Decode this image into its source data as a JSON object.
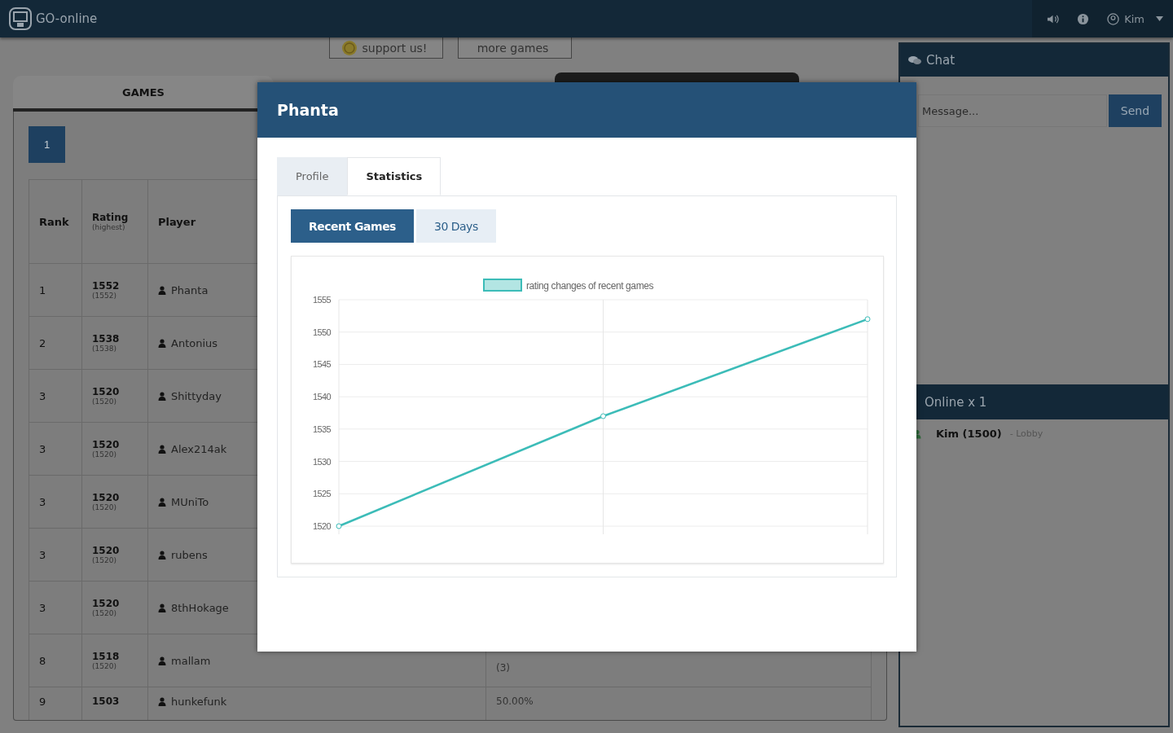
{
  "header": {
    "logo": "GO-online",
    "user": "Kim"
  },
  "top_buttons": [
    "support us!",
    "more games"
  ],
  "games_tab": {
    "label": "GAMES"
  },
  "pagination": [
    {
      "label": "1",
      "selected": true
    }
  ],
  "table": {
    "columns": [
      "Rank",
      "Rating",
      "Player"
    ],
    "rating_note": "(highest)",
    "rows": [
      {
        "rank": "1",
        "rating": "1552",
        "highest": "(1552)",
        "player": "Phanta"
      },
      {
        "rank": "2",
        "rating": "1538",
        "highest": "(1538)",
        "player": "Antonius"
      },
      {
        "rank": "3",
        "rating": "1520",
        "highest": "(1520)",
        "player": "Shittyday"
      },
      {
        "rank": "3",
        "rating": "1520",
        "highest": "(1520)",
        "player": "Alex214ak"
      },
      {
        "rank": "3",
        "rating": "1520",
        "highest": "(1520)",
        "player": "MUniTo"
      },
      {
        "rank": "3",
        "rating": "1520",
        "highest": "(1520)",
        "player": "rubens"
      },
      {
        "rank": "3",
        "rating": "1520",
        "highest": "(1520)",
        "player": "8thHokage"
      },
      {
        "rank": "8",
        "rating": "1518",
        "highest": "(1520)",
        "player": "mallam",
        "column_4_note": "(3)"
      },
      {
        "rank": "9",
        "rating": "1503",
        "player": "hunkefunk",
        "column_4": "50.00%"
      }
    ]
  },
  "chat": {
    "title": "Chat",
    "placeholder": "Message...",
    "send": "Send"
  },
  "online": {
    "title": "Online x 1",
    "users": [
      {
        "name": "Kim (1500)",
        "status": "- Lobby"
      }
    ]
  },
  "modal": {
    "title": "Phanta",
    "tabs": [
      {
        "label": "Profile",
        "selected": false
      },
      {
        "label": "Statistics",
        "selected": true
      }
    ],
    "range_buttons": [
      {
        "label": "Recent Games",
        "selected": true
      },
      {
        "label": "30 Days",
        "selected": false
      }
    ],
    "chart_data": {
      "type": "line",
      "grid": true,
      "ylim": [
        1520,
        1555
      ],
      "yticks": [
        1520,
        1525,
        1530,
        1535,
        1540,
        1545,
        1550,
        1555
      ],
      "series": [
        {
          "name": "rating changes of recent games",
          "color": "#3cbcb8",
          "marker": true,
          "values": [
            1520,
            1537,
            1552
          ]
        }
      ]
    }
  }
}
